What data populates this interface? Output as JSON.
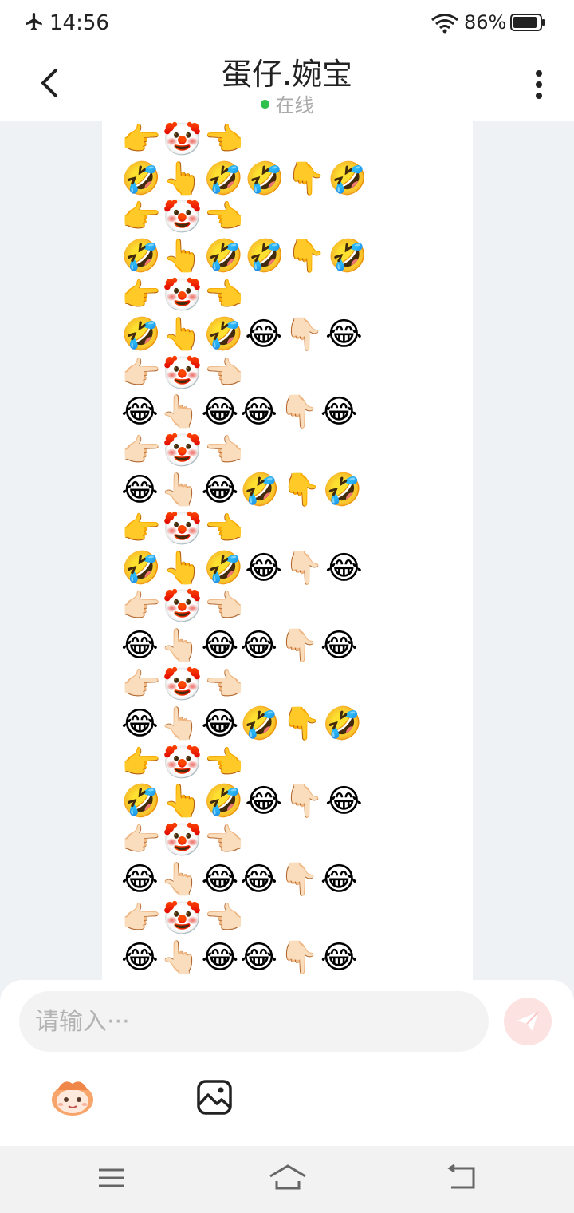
{
  "status_bar": {
    "time": "14:56",
    "battery": "86%"
  },
  "header": {
    "title": "蛋仔.婉宝",
    "status": "在线"
  },
  "messages": {
    "lines": [
      "😂👆🏻😂🤣👇🤣",
      "👉🤡👈",
      "🤣👆🤣🤣👇🤣",
      "👉🤡👈",
      "🤣👆🤣🤣👇🤣",
      "👉🤡👈",
      "🤣👆🤣😂👇🏻😂",
      "👉🏻🤡👈🏻",
      "😂👆🏻😂😂👇🏻😂",
      "👉🏻🤡👈🏻",
      "😂👆🏻😂🤣👇🤣",
      "👉🤡👈",
      "🤣👆🤣😂👇🏻😂",
      "👉🏻🤡👈🏻",
      "😂👆🏻😂😂👇🏻😂",
      "👉🏻🤡👈🏻",
      "😂👆🏻😂🤣👇🤣",
      "👉🤡👈",
      "🤣👆🤣😂👇🏻😂",
      "👉🏻🤡👈🏻",
      "😂👆🏻😂😂👇🏻😂",
      "👉🏻🤡👈🏻",
      "😂👆🏻😂😂👇🏻😂"
    ]
  },
  "composer": {
    "placeholder": "请输入···"
  },
  "icons": {
    "send": "send-icon",
    "sticker": "eggy-sticker-icon",
    "image": "image-icon",
    "accent_send_bg": "#fde2e2",
    "online_dot": "#2fbf4c"
  }
}
